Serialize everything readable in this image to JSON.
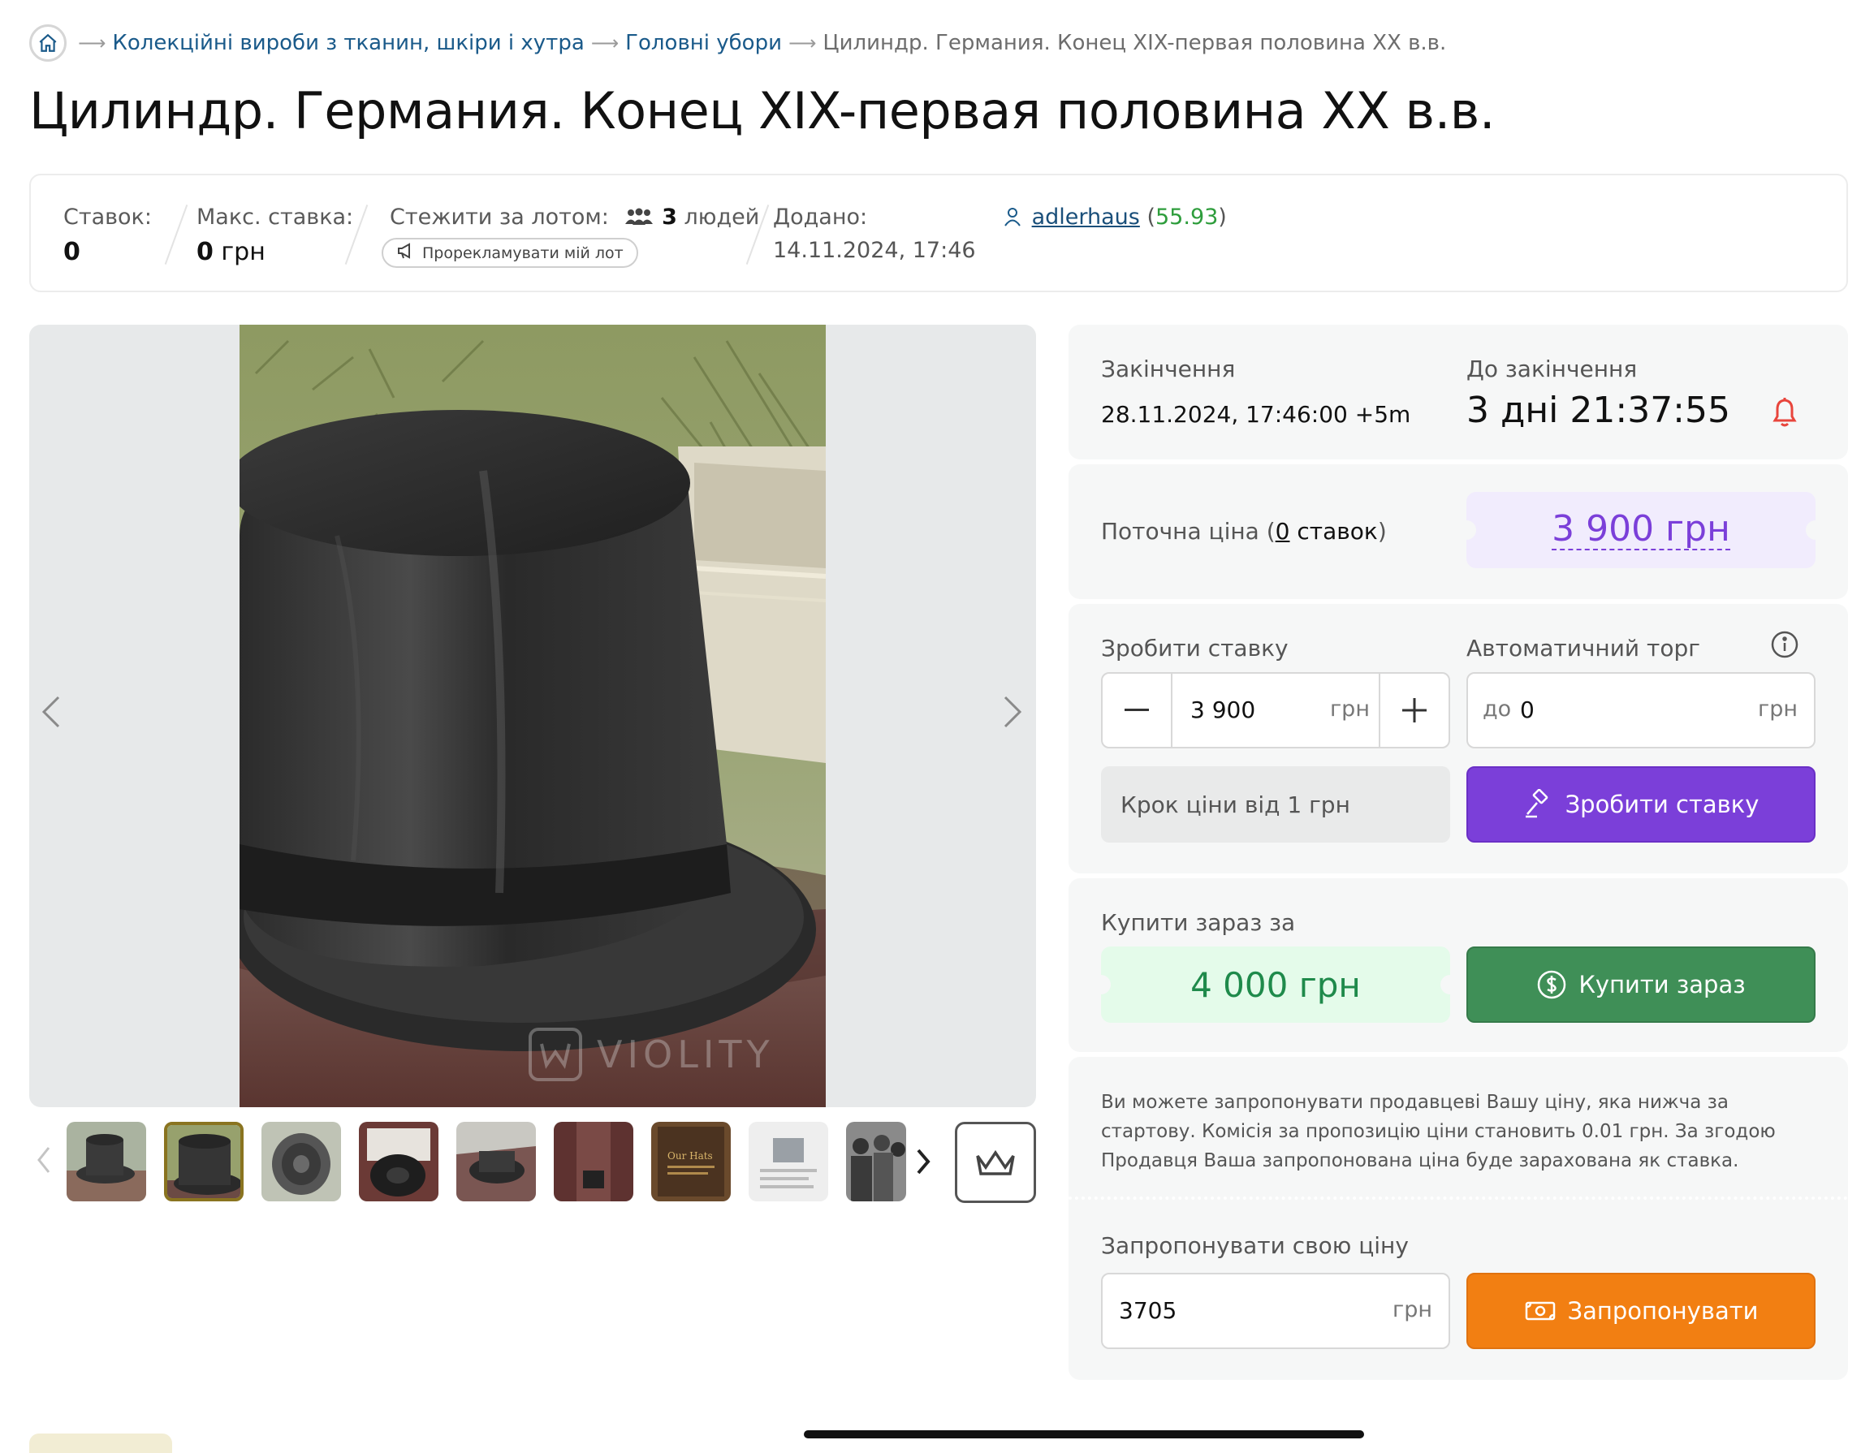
{
  "breadcrumb": {
    "items": [
      "Колекційні вироби з тканин, шкіри і хутра",
      "Головні убори"
    ],
    "current": "Цилиндр. Германия. Конец XIX-первая половина XX в.в."
  },
  "title": "Цилиндр. Германия. Конец XIX-первая половина XX в.в.",
  "stats": {
    "bids_label": "Ставок:",
    "bids_value": "0",
    "max_bid_label": "Макс. ставка:",
    "max_bid_value": "0",
    "max_bid_currency": "грн",
    "watch_label": "Стежити за лотом:",
    "watch_count": "3",
    "watch_unit": "людей",
    "promo_label": "Прорекламувати мій лот",
    "added_label": "Додано:",
    "added_value": "14.11.2024, 17:46",
    "seller_name": "adlerhaus",
    "seller_rating": "55.93"
  },
  "gallery": {
    "watermark": "VIOLITY"
  },
  "end_card": {
    "end_label": "Закінчення",
    "end_value": "28.11.2024, 17:46:00 +5m",
    "remaining_label": "До закінчення",
    "remaining_value": "3 дні 21:37:55"
  },
  "price_card": {
    "label": "Поточна ціна",
    "bids_count": "0",
    "bids_word": "ставок",
    "price": "3 900 грн"
  },
  "bid_card": {
    "bid_label": "Зробити ставку",
    "bid_value": "3 900",
    "currency": "грн",
    "auto_label": "Автоматичний торг",
    "auto_prefix": "до",
    "auto_value": "0",
    "step_text": "Крок ціни від 1 грн",
    "bid_button": "Зробити ставку"
  },
  "buy_card": {
    "label": "Купити зараз за",
    "price": "4 000 грн",
    "button": "Купити зараз"
  },
  "offer_card": {
    "info": "Ви можете запропонувати продавцеві Вашу ціну, яка нижча за стартову. Комісія за пропозицію ціни становить 0.01 грн. За згодою Продавця Ваша запропонована ціна буде зарахована як ставка.",
    "label": "Запропонувати свою ціну",
    "value": "3705",
    "currency": "грн",
    "button": "Запропонувати"
  },
  "colors": {
    "purple": "#7b3fd9",
    "purple_bg": "#f1ecfd",
    "green": "#3f8f57",
    "green_text": "#1f8a4b",
    "green_bg": "#e4fbea",
    "orange": "#f27f12",
    "link": "#1a5a8a",
    "rating": "#2e9d3c",
    "bell": "#e8453c"
  }
}
